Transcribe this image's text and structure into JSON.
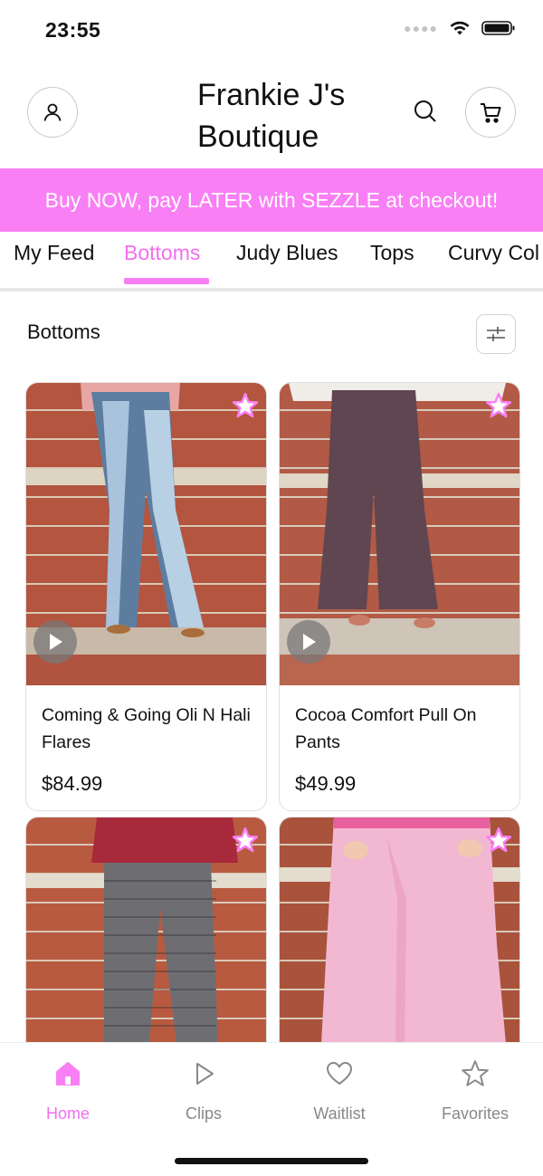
{
  "status": {
    "time": "23:55"
  },
  "header": {
    "store_name": "Frankie J's Boutique"
  },
  "promo": {
    "text": "Buy NOW, pay LATER with SEZZLE at checkout!"
  },
  "tabs": [
    {
      "label": "My Feed",
      "active": false
    },
    {
      "label": "Bottoms",
      "active": true
    },
    {
      "label": "Judy Blues",
      "active": false
    },
    {
      "label": "Tops",
      "active": false
    },
    {
      "label": "Curvy Col",
      "active": false
    }
  ],
  "section": {
    "title": "Bottoms"
  },
  "products": [
    {
      "name": "Coming & Going Oli N Hali Flares",
      "price": "$84.99",
      "has_video": true
    },
    {
      "name": "Cocoa Comfort Pull On Pants",
      "price": "$49.99",
      "has_video": true
    },
    {
      "name": "",
      "price": "",
      "has_video": false
    },
    {
      "name": "",
      "price": "",
      "has_video": false
    }
  ],
  "tabbar": [
    {
      "label": "Home",
      "icon": "home-icon",
      "active": true
    },
    {
      "label": "Clips",
      "icon": "play-icon",
      "active": false
    },
    {
      "label": "Waitlist",
      "icon": "heart-icon",
      "active": false
    },
    {
      "label": "Favorites",
      "icon": "star-icon",
      "active": false
    }
  ],
  "colors": {
    "accent": "#f97ff5",
    "accent_text": "#f36ef0",
    "muted": "#888888"
  }
}
